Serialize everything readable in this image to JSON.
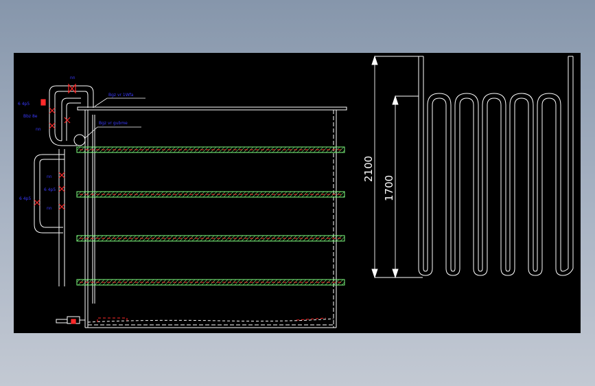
{
  "drawing": {
    "dimension_outer": "2100",
    "dimension_inner": "1700",
    "pipe_label_top": "Bgz vr 1Wfa",
    "pipe_label_mid": "Bgz vr gubme",
    "valve_labels": [
      "nn",
      "nn",
      "nn",
      "nn",
      "nn",
      "nn"
    ],
    "side_labels": [
      "6 4p5",
      "Bbz 8e",
      "6 4p5",
      "6 4p5"
    ]
  },
  "colors": {
    "background": "#000000",
    "line": "#ffffff",
    "shelf": "#7fff7f",
    "valve": "#ff2a2a",
    "label": "#2a2aff"
  }
}
